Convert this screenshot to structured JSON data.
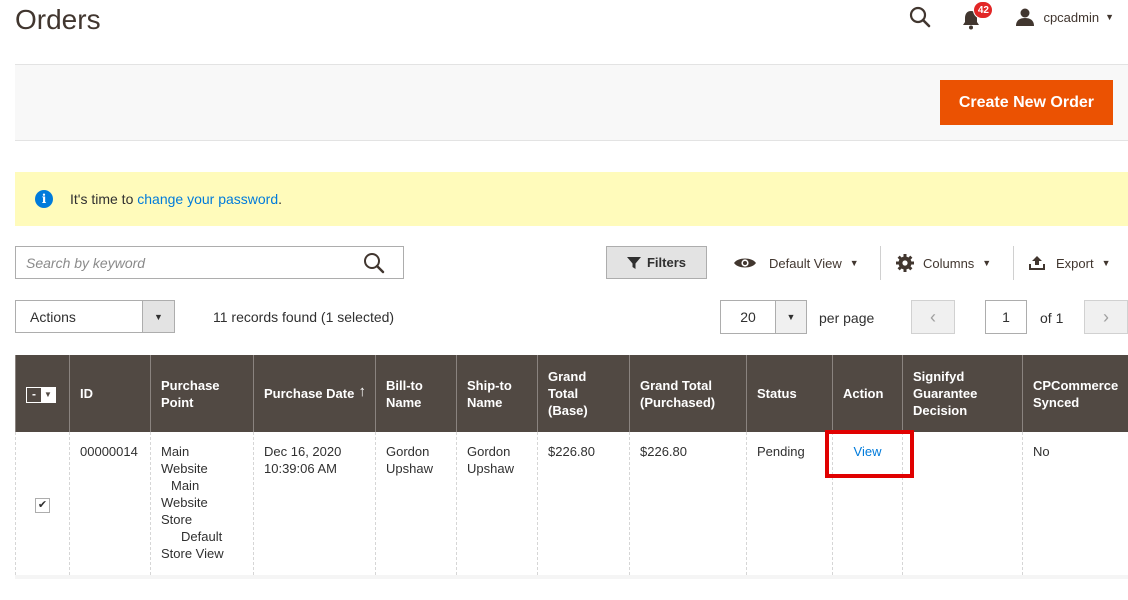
{
  "header": {
    "title": "Orders",
    "notifications_count": "42",
    "username": "cpcadmin",
    "icons": [
      "search-icon",
      "bell-icon",
      "user-icon",
      "chevron-down-icon"
    ]
  },
  "actions_bar": {
    "create_button": "Create New Order",
    "accent_color": "#eb5202"
  },
  "notice": {
    "prefix": "It's time to ",
    "link": "change your password",
    "suffix": "."
  },
  "toolbar": {
    "search_placeholder": "Search by keyword",
    "filters_label": "Filters",
    "view_label": "Default View",
    "columns_label": "Columns",
    "export_label": "Export"
  },
  "paging": {
    "actions_label": "Actions",
    "records_text": "11 records found (1 selected)",
    "per_page_value": "20",
    "per_page_label": "per page",
    "current_page": "1",
    "of_text": "of 1",
    "prev_glyph": "‹",
    "next_glyph": "›"
  },
  "table": {
    "columns": [
      "ID",
      "Purchase Point",
      "Purchase Date",
      "Bill-to Name",
      "Ship-to Name",
      "Grand Total (Base)",
      "Grand Total (Purchased)",
      "Status",
      "Action",
      "Signifyd Guarantee Decision",
      "CPCommerce Synced"
    ],
    "sort_arrow": "↑",
    "rows": [
      {
        "checked": true,
        "id": "00000014",
        "purchase_point": [
          "Main",
          "Website",
          "Main",
          "Website",
          "Store",
          "Default",
          "Store View"
        ],
        "purchase_date": "Dec 16, 2020 10:39:06 AM",
        "bill_to": "Gordon Upshaw",
        "ship_to": "Gordon Upshaw",
        "grand_total_base": "$226.80",
        "grand_total_purchased": "$226.80",
        "status": "Pending",
        "action": "View",
        "signifyd": "",
        "cpcommerce_synced": "No"
      }
    ]
  }
}
